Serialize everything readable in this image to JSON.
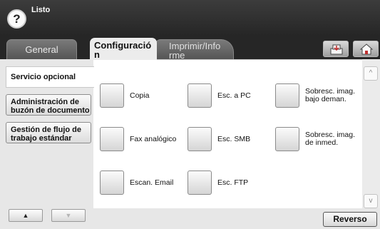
{
  "status": {
    "text": "Listo",
    "help_symbol": "?"
  },
  "tabs": {
    "general": "General",
    "config_line1": "Configuració",
    "config_line2": "n",
    "print_line1": "Imprimir/Info",
    "print_line2": "rme"
  },
  "toolbar": {
    "job_status_icon": "job-status-icon",
    "home_icon": "home-icon"
  },
  "sidebar": {
    "active": "Servicio opcional",
    "item1_line1": "Administración de",
    "item1_line2": "buzón de documento",
    "item2_line1": "Gestión de flujo de",
    "item2_line2": "trabajo estándar",
    "up_arrow": "▲",
    "down_arrow": "▼"
  },
  "options": {
    "copia": "Copia",
    "esc_pc": "Esc. a PC",
    "sobre_bajo_l1": "Sobresc. imag.",
    "sobre_bajo_l2": "bajo deman.",
    "fax": "Fax analógico",
    "esc_smb": "Esc. SMB",
    "sobre_inmed_l1": "Sobresc. imag.",
    "sobre_inmed_l2": "de inmed.",
    "escan_email": "Escan. Email",
    "esc_ftp": "Esc. FTP"
  },
  "scroll": {
    "up": "^",
    "down": "v"
  },
  "footer": {
    "reverso": "Reverso"
  }
}
